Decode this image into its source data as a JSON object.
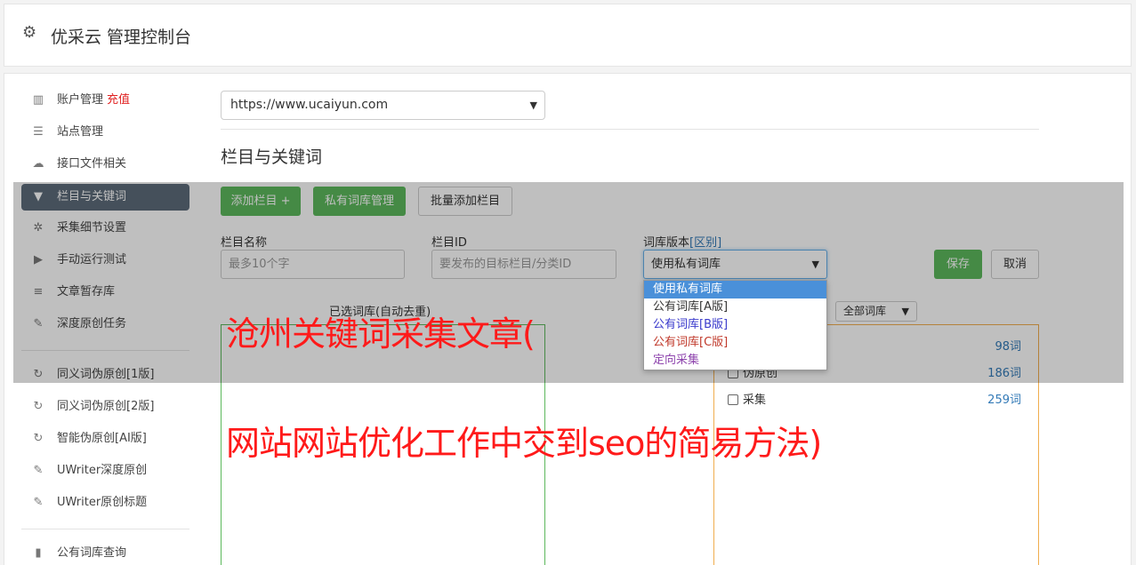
{
  "header": {
    "title": "优采云 管理控制台",
    "icon": "gear-icon"
  },
  "sidebar": {
    "items": [
      {
        "label": "账户管理",
        "extra": "充值",
        "icon": "bar-chart-icon"
      },
      {
        "label": "站点管理",
        "icon": "server-icon"
      },
      {
        "label": "接口文件相关",
        "icon": "cloud-upload-icon"
      },
      {
        "label": "栏目与关键词",
        "icon": "filter-icon",
        "active": true
      },
      {
        "label": "采集细节设置",
        "icon": "gears-icon"
      },
      {
        "label": "手动运行测试",
        "icon": "play-icon"
      },
      {
        "label": "文章暂存库",
        "icon": "database-icon"
      },
      {
        "label": "深度原创任务",
        "icon": "edit-icon"
      },
      {
        "label": "同义词伪原创[1版]",
        "icon": "refresh-icon"
      },
      {
        "label": "同义词伪原创[2版]",
        "icon": "refresh-icon"
      },
      {
        "label": "智能伪原创[AI版]",
        "icon": "refresh-icon"
      },
      {
        "label": "UWriter深度原创",
        "icon": "edit-icon"
      },
      {
        "label": "UWriter原创标题",
        "icon": "edit-icon"
      },
      {
        "label": "公有词库查询",
        "icon": "book-icon"
      }
    ]
  },
  "main": {
    "site_select": "https://www.ucaiyun.com",
    "section_title": "栏目与关键词",
    "buttons": {
      "add_column": "添加栏目 +",
      "private_lib": "私有词库管理",
      "batch_add": "批量添加栏目",
      "save": "保存",
      "cancel": "取消"
    },
    "fields": {
      "column_name_label": "栏目名称",
      "column_name_placeholder": "最多10个字",
      "column_id_label": "栏目ID",
      "column_id_placeholder": "要发布的目标栏目/分类ID",
      "lib_version_label": "词库版本",
      "lib_version_link": "[区别]",
      "lib_version_value": "使用私有词库"
    },
    "dropdown_options": [
      {
        "label": "使用私有词库",
        "color": "#ffffff"
      },
      {
        "label": "公有词库[A版]",
        "color": "#333333"
      },
      {
        "label": "公有词库[B版]",
        "color": "#3a3acc"
      },
      {
        "label": "公有词库[C版]",
        "color": "#c0392b"
      },
      {
        "label": "定向采集",
        "color": "#8e44ad"
      }
    ],
    "selected_label": "已选词库(自动去重)",
    "all_libs_select": "全部词库",
    "libs": [
      {
        "name": "",
        "count": "98词"
      },
      {
        "name": "伪原创",
        "count": "186词"
      },
      {
        "name": "采集",
        "count": "259词"
      }
    ]
  },
  "banner": {
    "line1": "沧州关键词采集文章(",
    "line2": "网站网站优化工作中交到seo的简易方法)"
  }
}
